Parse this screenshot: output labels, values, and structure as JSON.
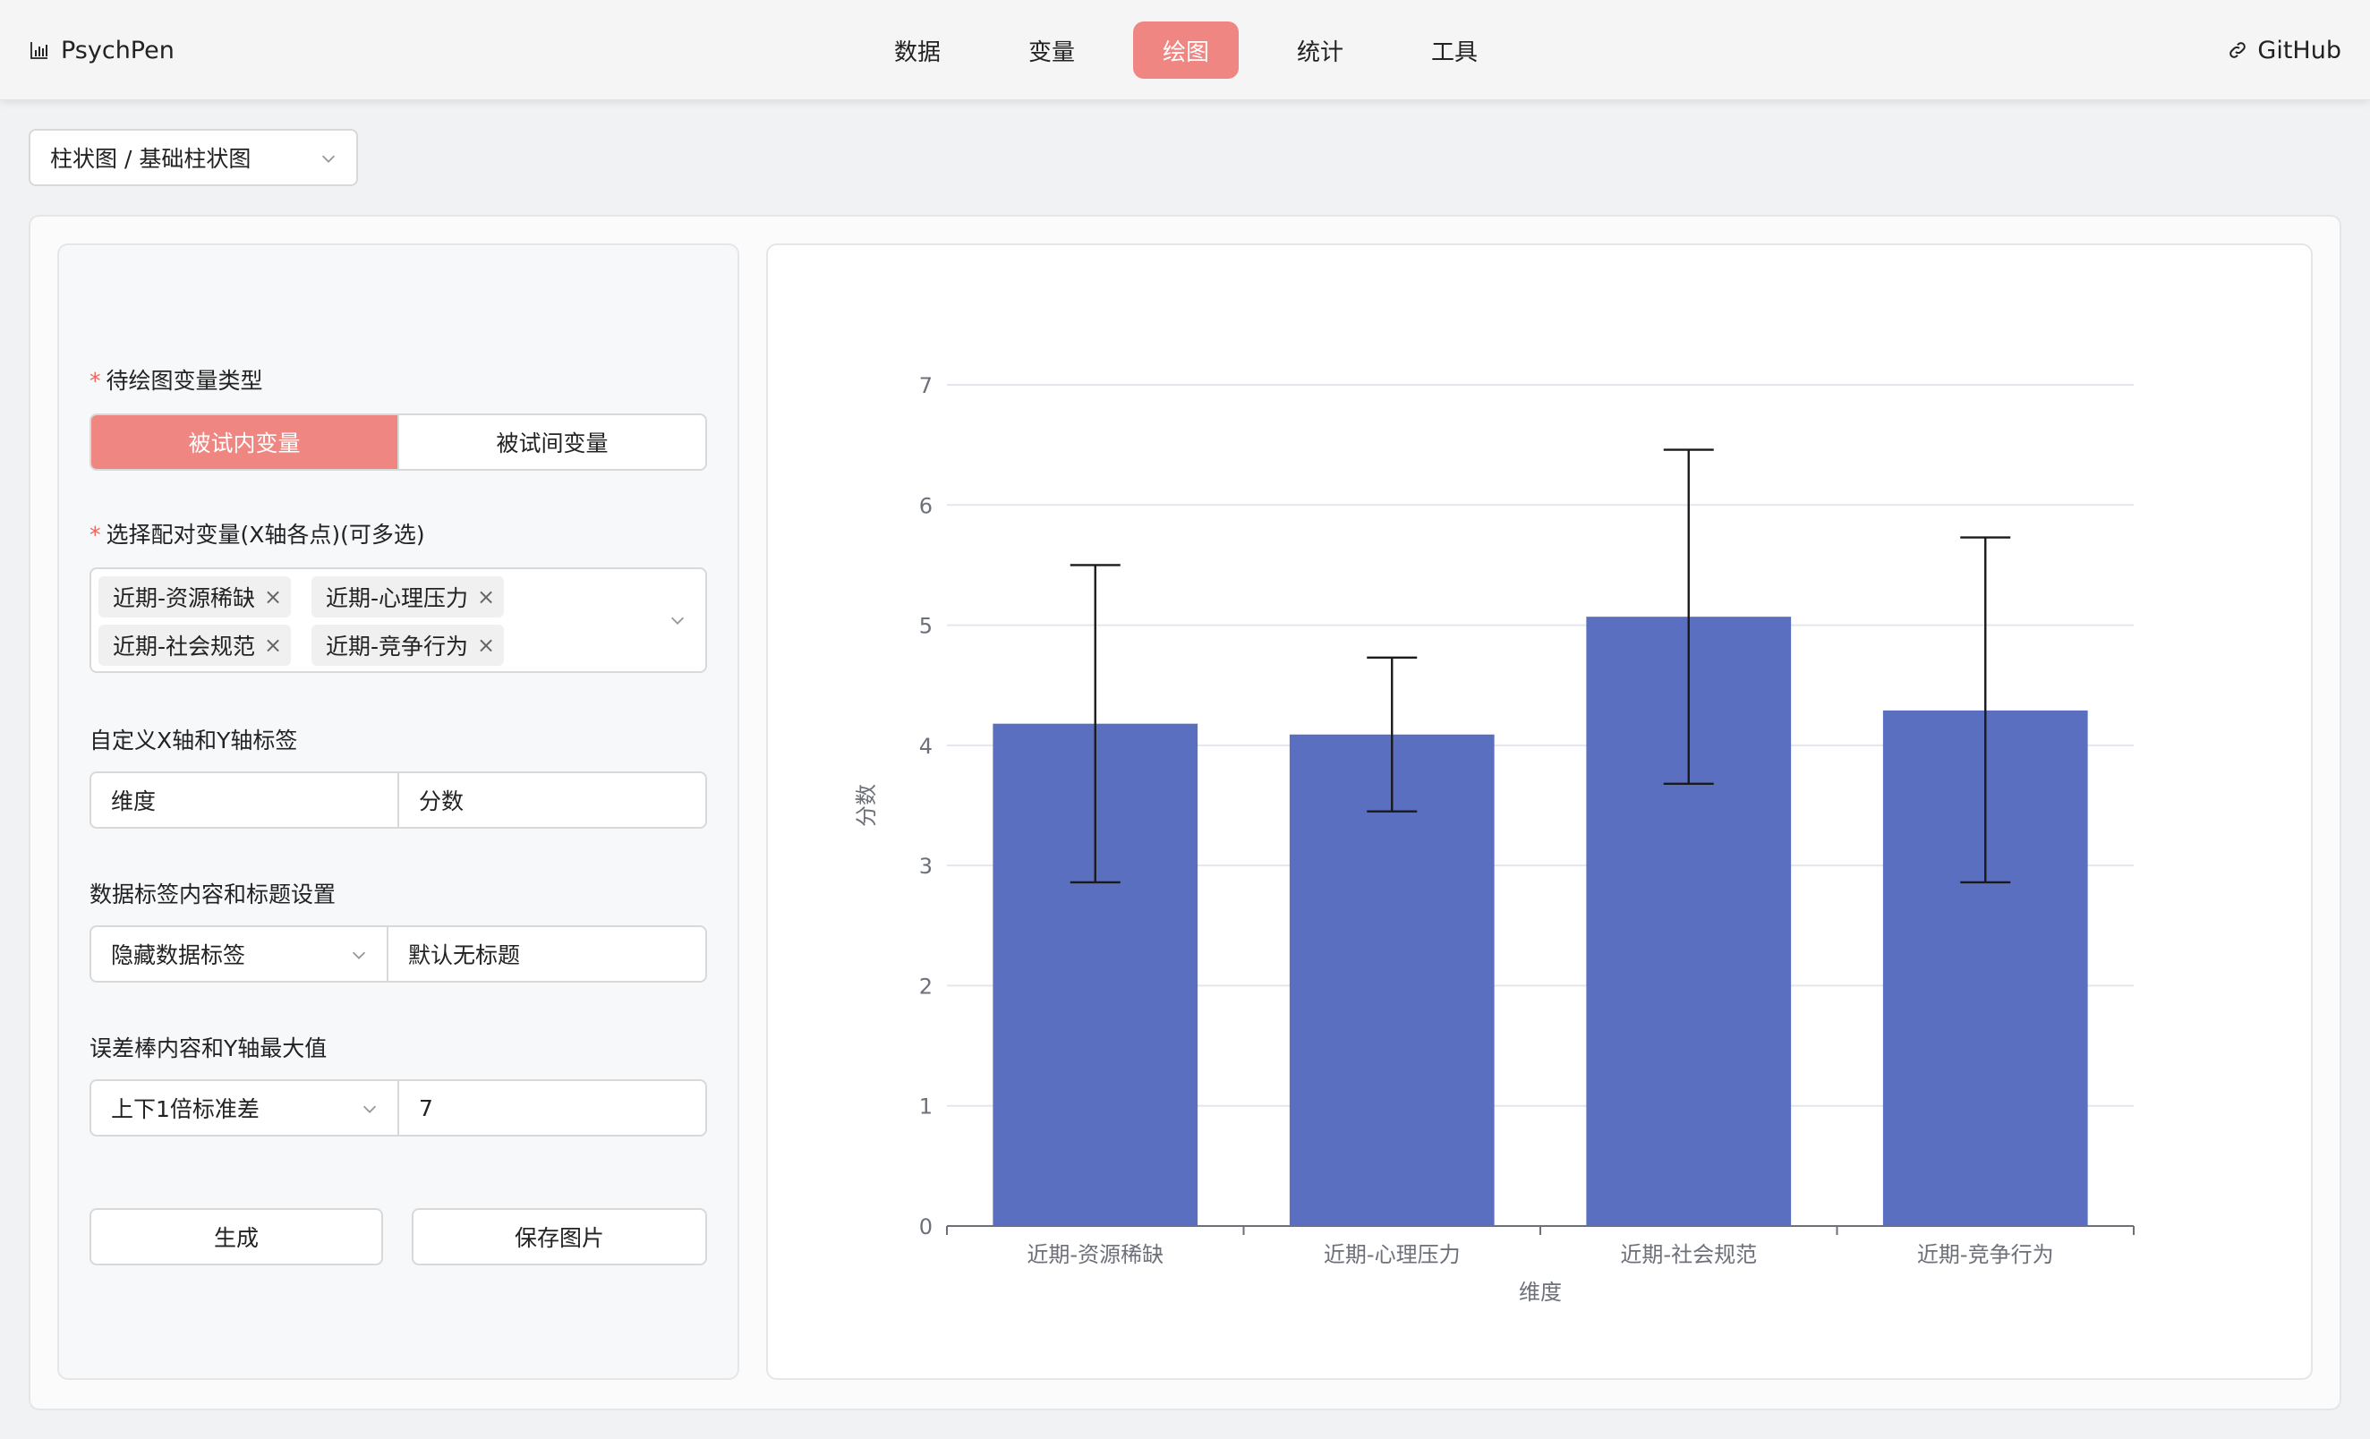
{
  "header": {
    "brand": "PsychPen",
    "nav": [
      "数据",
      "变量",
      "绘图",
      "统计",
      "工具"
    ],
    "active_nav": "绘图",
    "github": "GitHub"
  },
  "chart_type_select": {
    "value": "柱状图 / 基础柱状图"
  },
  "form": {
    "var_type_label": "待绘图变量类型",
    "var_type_options": [
      "被试内变量",
      "被试间变量"
    ],
    "var_type_selected": "被试内变量",
    "paired_vars_label": "选择配对变量(X轴各点)(可多选)",
    "paired_vars": [
      "近期-资源稀缺",
      "近期-心理压力",
      "近期-社会规范",
      "近期-竞争行为"
    ],
    "axis_labels_label": "自定义X轴和Y轴标签",
    "x_axis_label_value": "维度",
    "y_axis_label_value": "分数",
    "data_label_section": "数据标签内容和标题设置",
    "data_label_select": "隐藏数据标签",
    "title_placeholder": "默认无标题",
    "error_bar_section": "误差棒内容和Y轴最大值",
    "error_bar_select": "上下1倍标准差",
    "y_max_value": "7",
    "generate_button": "生成",
    "save_button": "保存图片"
  },
  "chart_data": {
    "type": "bar",
    "categories": [
      "近期-资源稀缺",
      "近期-心理压力",
      "近期-社会规范",
      "近期-竞争行为"
    ],
    "values": [
      4.18,
      4.09,
      5.07,
      4.29
    ],
    "error_low": [
      2.86,
      3.45,
      3.68,
      2.86
    ],
    "error_high": [
      5.5,
      4.73,
      6.46,
      5.73
    ],
    "xlabel": "维度",
    "ylabel": "分数",
    "ylim": [
      0,
      7
    ],
    "yticks": [
      0,
      1,
      2,
      3,
      4,
      5,
      6,
      7
    ],
    "grid": true,
    "bar_color": "#5b6fc0"
  }
}
